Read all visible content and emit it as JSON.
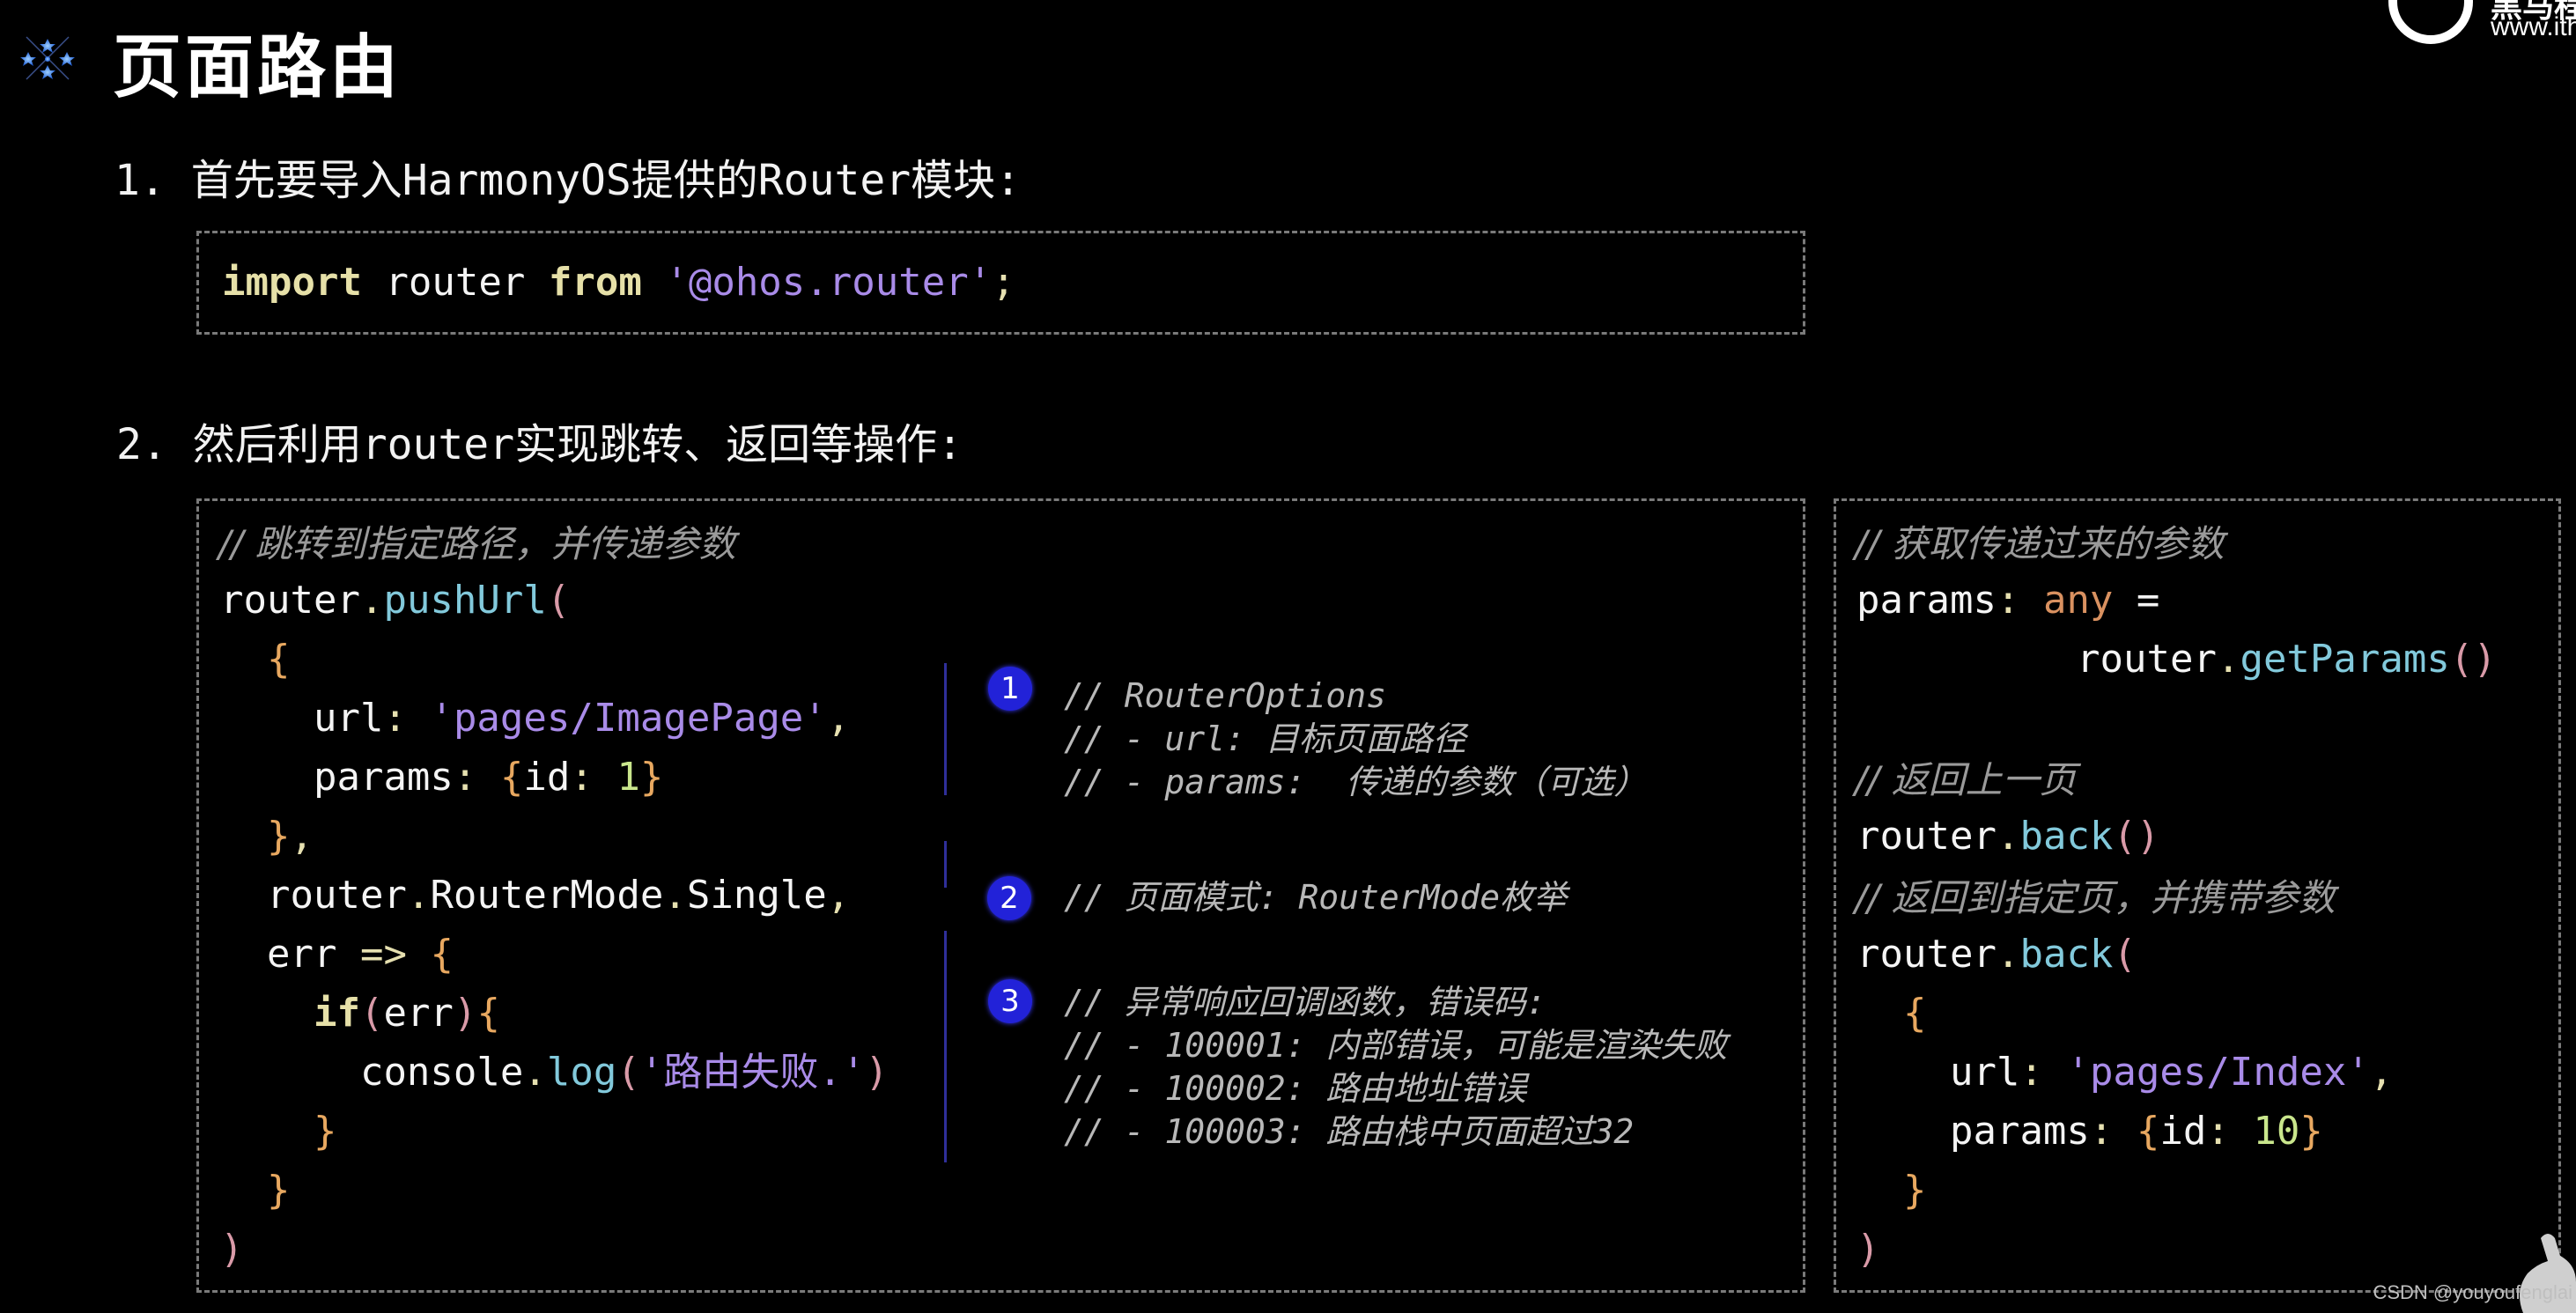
{
  "slide": {
    "title": "页面路由",
    "title_icon": "sparkle-stars-icon"
  },
  "logo": {
    "brand_cn": "黑马程",
    "url_text": "www.ithe"
  },
  "step1": {
    "heading": "1. 首先要导入HarmonyOS提供的Router模块:",
    "code": {
      "kw_import": "import",
      "ident": " router ",
      "kw_from": "from",
      "space": " ",
      "string": "'@ohos.router'",
      "semicolon": ";"
    }
  },
  "step2": {
    "heading": "2. 然后利用router实现跳转、返回等操作:"
  },
  "main_code": {
    "comment": "// 跳转到指定路径，并传递参数",
    "l1_obj": "router",
    "l1_dot": ".",
    "l1_fn": "pushUrl",
    "l1_paren": "(",
    "l2_brace": "{",
    "l3_key": "url",
    "l3_colon": ":",
    "l3_str": "'pages/ImagePage'",
    "l3_comma": ",",
    "l4_key": "params",
    "l4_colon": ":",
    "l4_open": "{",
    "l4_inner": "id",
    "l4_colon2": ":",
    "l4_num": "1",
    "l4_close": "}",
    "l5_brace": "}",
    "l5_comma": ",",
    "l6_a": "router",
    "l6_dot1": ".",
    "l6_b": "RouterMode",
    "l6_dot2": ".",
    "l6_c": "Single",
    "l6_comma": ",",
    "l7_err": "err",
    "l7_arrow": " => ",
    "l7_brace": "{",
    "l8_kw": "if",
    "l8_open": "(",
    "l8_err": "err",
    "l8_close": ")",
    "l8_brace": "{",
    "l9_obj": "console",
    "l9_dot": ".",
    "l9_fn": "log",
    "l9_open": "(",
    "l9_str": "'路由失败.'",
    "l9_close": ")",
    "l10_brace": "}",
    "l11_brace": "}",
    "l12_paren": ")"
  },
  "annotations": [
    {
      "badge": "1",
      "lines": [
        "// RouterOptions",
        "// - url: 目标页面路径",
        "// - params:  传递的参数（可选）"
      ]
    },
    {
      "badge": "2",
      "lines": [
        "// 页面模式: RouterMode枚举"
      ]
    },
    {
      "badge": "3",
      "lines": [
        "// 异常响应回调函数，错误码:",
        "// - 100001: 内部错误，可能是渲染失败",
        "// - 100002: 路由地址错误",
        "// - 100003: 路由栈中页面超过32"
      ]
    }
  ],
  "right_code": {
    "comment1": "// 获取传递过来的参数",
    "r1_key": "params",
    "r1_colon": ":",
    "r1_type": "any",
    "r1_eq": " =",
    "r2_obj": "router",
    "r2_dot": ".",
    "r2_fn": "getParams",
    "r2_parens": "()",
    "comment2": "// 返回上一页",
    "r3_obj": "router",
    "r3_dot": ".",
    "r3_fn": "back",
    "r3_parens": "()",
    "comment3": "// 返回到指定页，并携带参数",
    "r4_obj": "router",
    "r4_dot": ".",
    "r4_fn": "back",
    "r4_paren": "(",
    "r5_brace": "{",
    "r6_key": "url",
    "r6_colon": ":",
    "r6_str": "'pages/Index'",
    "r6_comma": ",",
    "r7_key": "params",
    "r7_colon": ":",
    "r7_open": "{",
    "r7_inner": "id",
    "r7_colon2": ":",
    "r7_num": "10",
    "r7_close": "}",
    "r8_brace": "}",
    "r9_paren": ")"
  },
  "watermark": "CSDN @youyoufenglai"
}
